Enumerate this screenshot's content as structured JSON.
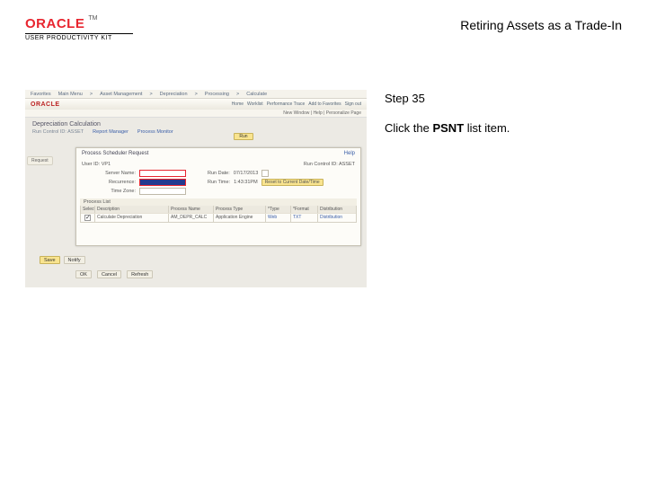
{
  "branding": {
    "logo_text": "ORACLE",
    "tm": "TM",
    "product_line": "USER PRODUCTIVITY KIT"
  },
  "topic_title": "Retiring Assets as a Trade-In",
  "instruction": {
    "step_label": "Step 35",
    "text_prefix": "Click the ",
    "text_bold": "PSNT",
    "text_suffix": " list item."
  },
  "screenshot": {
    "nav_items": [
      "Favorites",
      "Main Menu",
      "Asset Management",
      "Depreciation",
      "Processing",
      "Calculate"
    ],
    "brand": "ORACLE",
    "tabs": [
      "Home",
      "Worklist",
      "Performance Trace",
      "Add to Favorites",
      "Sign out"
    ],
    "toolbar_right": "New Window | Help | Personalize Page",
    "page_title": "Depreciation Calculation",
    "sub_links": [
      "Run Control ID: ASSET",
      "Report Manager",
      "Process Monitor"
    ],
    "run_btn": "Run",
    "side_tab": "Request",
    "modal": {
      "title": "Process Scheduler Request",
      "help": "Help",
      "user_label": "User ID:",
      "user_value": "VP1",
      "runctl_label": "Run Control ID:",
      "runctl_value": "ASSET",
      "server_label": "Server Name:",
      "rundate_label": "Run Date:",
      "rundate_value": "07/17/2013",
      "recurrence_label": "Recurrence:",
      "runtime_label": "Run Time:",
      "runtime_value": "1:43:31PM",
      "reset_btn": "Reset to Current Date/Time",
      "timezone_label": "Time Zone:",
      "process_list": "Process List",
      "headers": [
        "Select",
        "Description",
        "Process Name",
        "Process Type",
        "*Type",
        "*Format",
        "Distribution"
      ],
      "row": {
        "desc": "Calculate Depreciation",
        "pname": "AM_DEPR_CALC",
        "ptype": "Application Engine",
        "type": "Web",
        "format": "TXT",
        "dist": "Distribution"
      }
    },
    "save_row": [
      "Save",
      "Notify"
    ],
    "ok_row": [
      "OK",
      "Cancel",
      "Refresh"
    ]
  }
}
